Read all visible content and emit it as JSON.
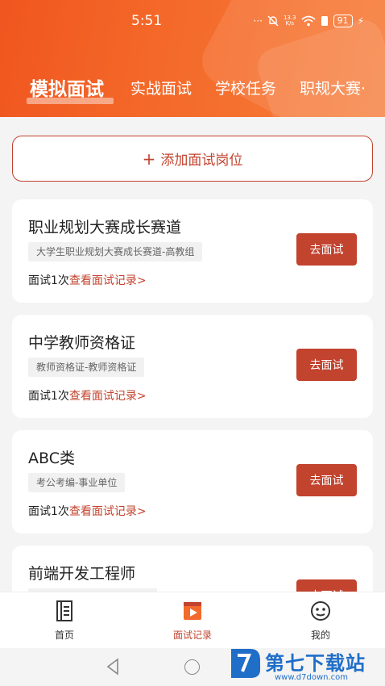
{
  "status_bar": {
    "time": "5:51",
    "dots": "···",
    "net_speed_value": "13.3",
    "net_speed_unit": "K/s",
    "battery": "91"
  },
  "top_tabs": [
    {
      "label": "模拟面试",
      "active": true
    },
    {
      "label": "实战面试",
      "active": false
    },
    {
      "label": "学校任务",
      "active": false
    },
    {
      "label": "职规大赛·",
      "active": false
    }
  ],
  "add_button": {
    "plus": "+",
    "label": "添加面试岗位"
  },
  "cards": [
    {
      "title": "职业规划大赛成长赛道",
      "tag": "大学生职业规划大赛成长赛道-高教组",
      "count": "面试1次",
      "link": "查看面试记录>",
      "button": "去面试"
    },
    {
      "title": "中学教师资格证",
      "tag": "教师资格证-教师资格证",
      "count": "面试1次",
      "link": "查看面试记录>",
      "button": "去面试"
    },
    {
      "title": "ABC类",
      "tag": "考公考编-事业单位",
      "count": "面试1次",
      "link": "查看面试记录>",
      "button": "去面试"
    },
    {
      "title": "前端开发工程师",
      "tag": "",
      "count": "",
      "link": "",
      "button": "去面试"
    }
  ],
  "bottom_tabs": [
    {
      "label": "首页",
      "icon": "home-doc-icon",
      "active": false
    },
    {
      "label": "面试记录",
      "icon": "record-play-icon",
      "active": true
    },
    {
      "label": "我的",
      "icon": "smiley-face-icon",
      "active": false
    }
  ],
  "watermark": {
    "text": "第七下载站",
    "url": "www.d7down.com"
  },
  "colors": {
    "brand": "#c2432e",
    "header": "#f2601f"
  }
}
